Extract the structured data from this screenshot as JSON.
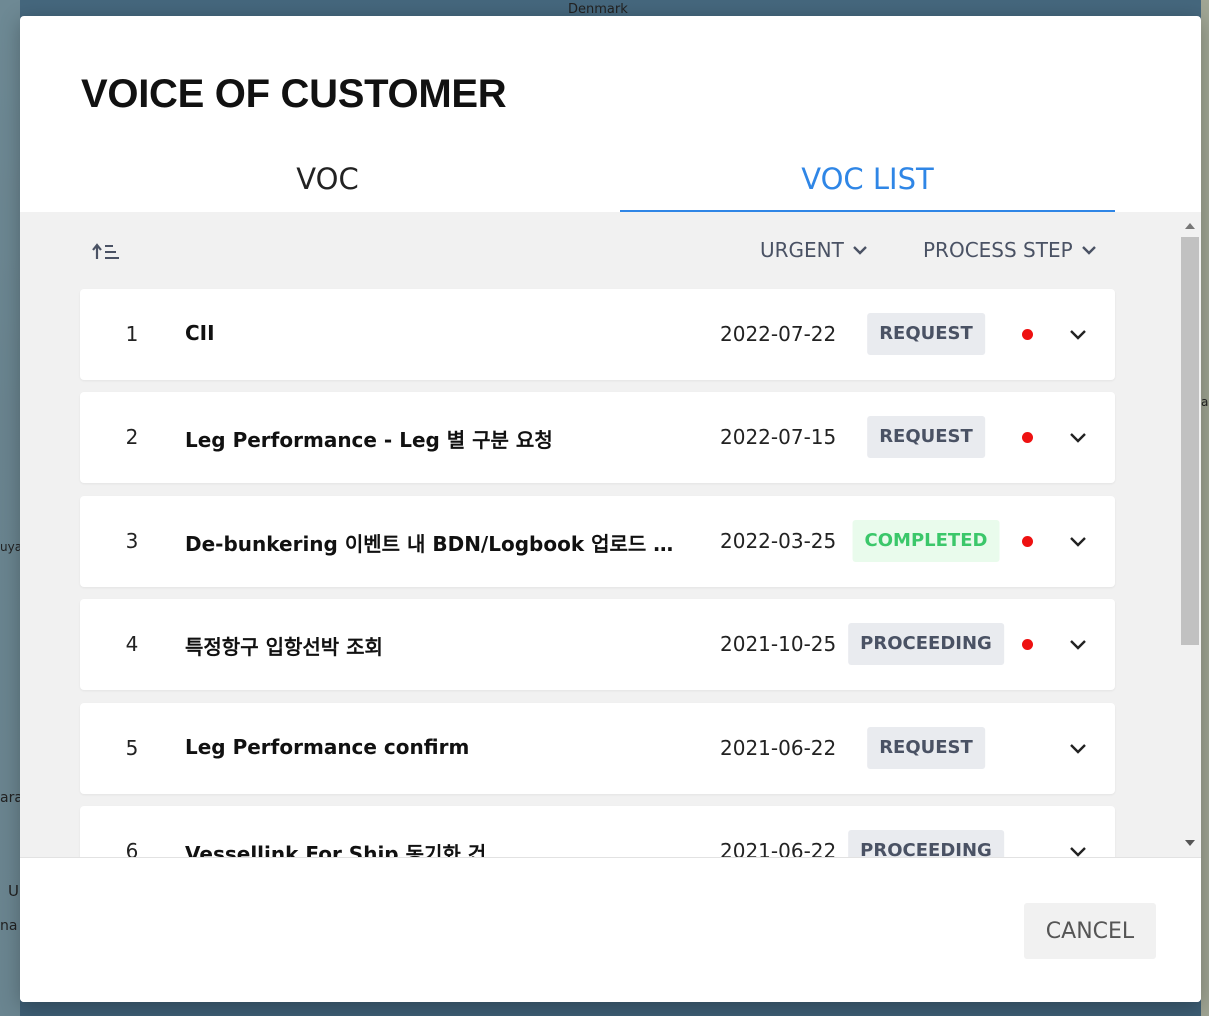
{
  "background": {
    "map_labels": [
      "Denmark",
      "uya",
      "ara",
      "U",
      "na",
      "a"
    ]
  },
  "modal": {
    "title": "VOICE OF CUSTOMER",
    "tabs": [
      {
        "label": "VOC",
        "active": false
      },
      {
        "label": "VOC LIST",
        "active": true
      }
    ],
    "accent_color": "#2f86e6",
    "toolbar": {
      "sort_icon": "sort-ascending-icon",
      "filters": [
        {
          "label": "URGENT"
        },
        {
          "label": "PROCESS STEP"
        }
      ]
    },
    "rows": [
      {
        "no": "1",
        "title": "CII",
        "date": "2022-07-22",
        "status": "REQUEST",
        "urgent": true
      },
      {
        "no": "2",
        "title": "Leg Performance - Leg 별 구분 요청",
        "date": "2022-07-15",
        "status": "REQUEST",
        "urgent": true
      },
      {
        "no": "3",
        "title": "De-bunkering 이벤트 내 BDN/Logbook 업로드 기능...",
        "date": "2022-03-25",
        "status": "COMPLETED",
        "urgent": true
      },
      {
        "no": "4",
        "title": "특정항구 입항선박 조회",
        "date": "2021-10-25",
        "status": "PROCEEDING",
        "urgent": true
      },
      {
        "no": "5",
        "title": "Leg Performance confirm",
        "date": "2021-06-22",
        "status": "REQUEST",
        "urgent": false
      },
      {
        "no": "6",
        "title": "Vessellink For Ship 동기화 건",
        "date": "2021-06-22",
        "status": "PROCEEDING",
        "urgent": false
      }
    ],
    "status_colors": {
      "REQUEST": "#4a5264",
      "PROCEEDING": "#4a5264",
      "COMPLETED": "#3bc76a"
    },
    "urgent_dot_color": "#ee1111",
    "footer": {
      "cancel_label": "CANCEL"
    }
  }
}
